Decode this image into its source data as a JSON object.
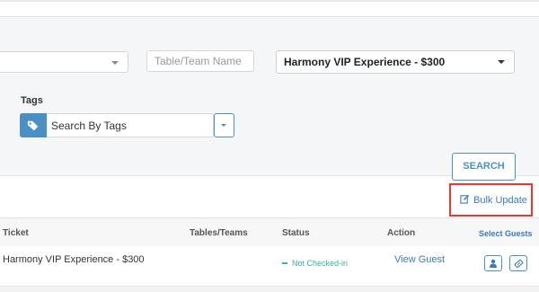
{
  "filters": {
    "left_select_value": "",
    "team_placeholder": "Table/Team Name",
    "ticket_select_value": "Harmony VIP Experience - $300",
    "tags_label": "Tags",
    "tags_placeholder": "Search By Tags",
    "search_label": "SEARCH"
  },
  "bulk_update_label": "Bulk Update",
  "table": {
    "headers": {
      "ticket": "Ticket",
      "tables_teams": "Tables/Teams",
      "status": "Status",
      "action": "Action",
      "select_guests": "Select Guests"
    },
    "rows": [
      {
        "ticket": "Harmony VIP Experience - $300",
        "tables_teams": "",
        "status": "Not Checked-in",
        "action": "View Guest"
      }
    ]
  },
  "colors": {
    "accent": "#4a90c4",
    "link": "#3a7bbd",
    "status_green": "#2fb5a0",
    "highlight_red": "#e53935"
  },
  "icons": {
    "tag_button": "tag-icon",
    "bulk_update": "edit-icon",
    "person_button": "person-icon",
    "ticket_button": "ticket-icon"
  }
}
